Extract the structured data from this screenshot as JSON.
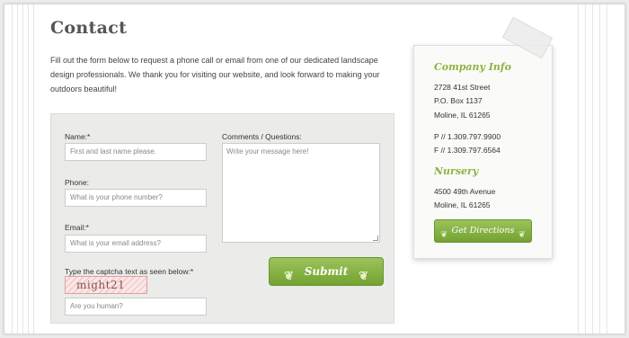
{
  "page": {
    "title": "Contact",
    "intro": "Fill out the form below to request a phone call or email from one of our dedicated landscape design professionals. We thank you for visiting our website, and look forward to making your outdoors beautiful!"
  },
  "form": {
    "name_label": "Name:*",
    "name_placeholder": "First and last name please.",
    "phone_label": "Phone:",
    "phone_placeholder": "What is your phone number?",
    "email_label": "Email:*",
    "email_placeholder": "What is your email address?",
    "comments_label": "Comments / Questions:",
    "comments_placeholder": "Write your message here!",
    "captcha_label": "Type the captcha text as seen below:*",
    "captcha_text": "might21",
    "captcha_placeholder": "Are you human?",
    "submit_label": "Submit"
  },
  "company": {
    "heading": "Company Info",
    "street": "2728 41st Street",
    "po_box": "P.O. Box 1137",
    "city": "Moline, IL 61265",
    "phone": "P //   1.309.797.9900",
    "fax": "F //   1.309.797.6564"
  },
  "nursery": {
    "heading": "Nursery",
    "street": "4500 49th Avenue",
    "city": "Moline, IL 61265",
    "directions_label": "Get Directions"
  },
  "colors": {
    "accent_green": "#8cb43f",
    "button_green": "#74a232"
  },
  "icons": {
    "leaf": "leaf-icon"
  }
}
